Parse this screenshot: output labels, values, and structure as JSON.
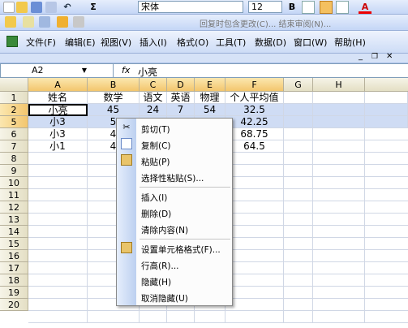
{
  "toolbar": {
    "font_name": "宋体",
    "font_size": "12",
    "bold": "B",
    "sum": "Σ",
    "review_text": "回复时包含更改(C)... 结束审阅(N)...",
    "font_color_label": "A"
  },
  "menubar": {
    "items": [
      "文件(F)",
      "编辑(E)",
      "视图(V)",
      "插入(I)",
      "格式(O)",
      "工具(T)",
      "数据(D)",
      "窗口(W)",
      "帮助(H)"
    ]
  },
  "formula_bar": {
    "name_box": "A2",
    "fx": "fx",
    "value": "小亮"
  },
  "sheet": {
    "columns": [
      "A",
      "B",
      "C",
      "D",
      "E",
      "F",
      "G",
      "H"
    ],
    "rows": [
      "1",
      "2",
      "5",
      "6",
      "7",
      "8",
      "9",
      "10",
      "11",
      "12",
      "13",
      "14",
      "15",
      "16",
      "17",
      "18",
      "19",
      "20"
    ],
    "header": [
      "姓名",
      "数学",
      "语文",
      "英语",
      "物理",
      "个人平均值"
    ],
    "data": [
      [
        "小亮",
        "45",
        "24",
        "7",
        "54",
        "32.5"
      ],
      [
        "小3",
        "5",
        "",
        "",
        "",
        "42.25"
      ],
      [
        "小3",
        "4",
        "",
        "",
        "",
        "68.75"
      ],
      [
        "小1",
        "4",
        "",
        "",
        "",
        "64.5"
      ]
    ]
  },
  "context_menu": {
    "items": [
      "剪切(T)",
      "复制(C)",
      "粘贴(P)",
      "选择性粘贴(S)...",
      "插入(I)",
      "删除(D)",
      "清除内容(N)",
      "设置单元格格式(F)...",
      "行高(R)...",
      "隐藏(H)",
      "取消隐藏(U)"
    ]
  }
}
